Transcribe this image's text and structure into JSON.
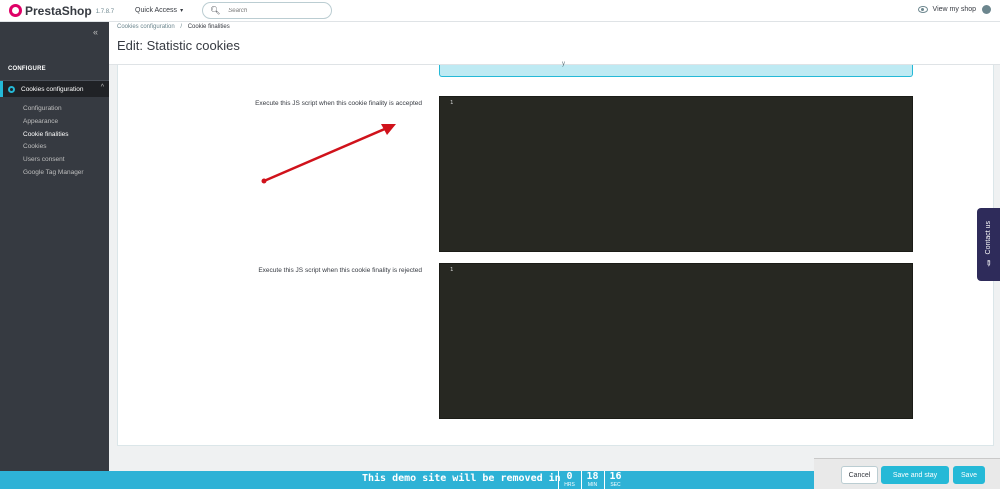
{
  "header": {
    "logo_name": "PrestaShop",
    "version": "1.7.8.7",
    "quick_access": "Quick Access",
    "search_placeholder": "Search",
    "view_shop": "View my shop"
  },
  "sidebar": {
    "section": "CONFIGURE",
    "parent": "Cookies configuration",
    "items": [
      {
        "label": "Configuration"
      },
      {
        "label": "Appearance"
      },
      {
        "label": "Cookie finalities"
      },
      {
        "label": "Cookies"
      },
      {
        "label": "Users consent"
      },
      {
        "label": "Google Tag Manager"
      }
    ],
    "active_item": "Cookie finalities"
  },
  "breadcrumb": {
    "parent": "Cookies configuration",
    "separator": "/",
    "current": "Cookie finalities"
  },
  "page_title": "Edit: Statistic cookies",
  "form": {
    "alert_trailing": "y",
    "accepted_label": "Execute this JS script when this cookie finality is accepted",
    "accepted_line": "1",
    "rejected_label": "Execute this JS script when this cookie finality is rejected",
    "rejected_line": "1"
  },
  "contact_tab": "Contact us",
  "demo_bar": {
    "text": "This demo site will be removed in",
    "hours": "0",
    "hours_unit": "HRS",
    "minutes": "18",
    "minutes_unit": "MIN",
    "seconds": "16",
    "seconds_unit": "SEC"
  },
  "actions": {
    "cancel": "Cancel",
    "save_and_stay": "Save and stay",
    "save": "Save"
  },
  "colors": {
    "accent": "#25b9d7",
    "sidebar": "#363a41",
    "editor_bg": "#272822",
    "annotation_arrow": "#d0121b"
  },
  "icons": [
    "prestashop-logo-icon",
    "chevron-down-icon",
    "search-icon",
    "eye-icon",
    "user-icon",
    "collapse-icon",
    "gear-icon",
    "chevron-up-icon",
    "pencil-icon"
  ]
}
